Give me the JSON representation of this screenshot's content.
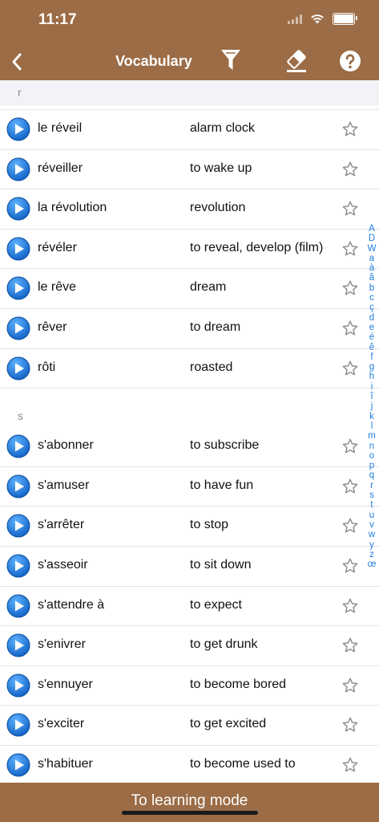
{
  "status_bar": {
    "time": "11:17"
  },
  "header": {
    "title": "Vocabulary"
  },
  "sections": [
    {
      "letter": "r",
      "rows": [
        {
          "fr": "le réveil",
          "en": "alarm clock"
        },
        {
          "fr": "réveiller",
          "en": "to wake up"
        },
        {
          "fr": "la révolution",
          "en": "revolution"
        },
        {
          "fr": "révéler",
          "en": "to reveal, develop (film)"
        },
        {
          "fr": "le rêve",
          "en": "dream"
        },
        {
          "fr": "rêver",
          "en": "to dream"
        },
        {
          "fr": "rôti",
          "en": "roasted"
        }
      ]
    },
    {
      "letter": "s",
      "rows": [
        {
          "fr": "s'abonner",
          "en": "to subscribe"
        },
        {
          "fr": "s'amuser",
          "en": "to have fun"
        },
        {
          "fr": "s'arrêter",
          "en": "to stop"
        },
        {
          "fr": "s'asseoir",
          "en": "to sit down"
        },
        {
          "fr": "s'attendre à",
          "en": "to expect"
        },
        {
          "fr": "s'enivrer",
          "en": "to get drunk"
        },
        {
          "fr": "s'ennuyer",
          "en": "to become bored"
        },
        {
          "fr": "s'exciter",
          "en": "to get excited"
        },
        {
          "fr": "s'habituer",
          "en": "to become used to"
        }
      ]
    }
  ],
  "index_letters": [
    "A",
    "D",
    "W",
    "a",
    "à",
    "â",
    "b",
    "c",
    "ç",
    "d",
    "e",
    "é",
    "ê",
    "f",
    "g",
    "h",
    "i",
    "î",
    "j",
    "k",
    "l",
    "m",
    "n",
    "o",
    "p",
    "q",
    "r",
    "s",
    "t",
    "u",
    "v",
    "w",
    "y",
    "z",
    "œ"
  ],
  "bottom_bar": {
    "learning_mode_label": "To learning mode"
  },
  "colors": {
    "brand": "#9b6c46",
    "accent": "#1f7fe0",
    "play_button": "#1677d8"
  },
  "icons": {
    "play": "play-circle-icon",
    "favorite": "star-outline-icon",
    "filter": "funnel-icon",
    "eraser": "eraser-icon",
    "help": "question-circle-icon",
    "back": "chevron-left-icon"
  }
}
